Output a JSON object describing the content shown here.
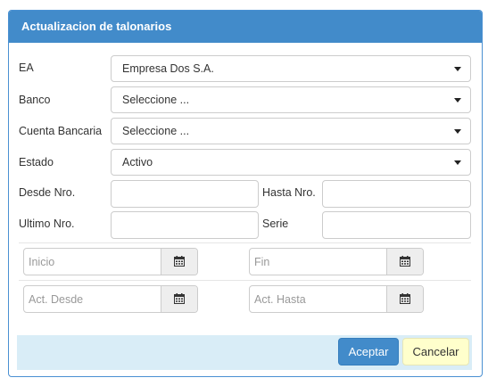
{
  "dialog": {
    "title": "Actualizacion de talonarios"
  },
  "form": {
    "ea": {
      "label": "EA",
      "value": "Empresa Dos S.A."
    },
    "banco": {
      "label": "Banco",
      "value": "Seleccione ..."
    },
    "cuenta": {
      "label": "Cuenta Bancaria",
      "value": "Seleccione ..."
    },
    "estado": {
      "label": "Estado",
      "value": "Activo"
    },
    "desde_nro": {
      "label": "Desde Nro.",
      "value": ""
    },
    "hasta_nro": {
      "label": "Hasta Nro.",
      "value": ""
    },
    "ultimo_nro": {
      "label": "Ultimo Nro.",
      "value": ""
    },
    "serie": {
      "label": "Serie",
      "value": ""
    },
    "inicio": {
      "placeholder": "Inicio"
    },
    "fin": {
      "placeholder": "Fin"
    },
    "act_desde": {
      "placeholder": "Act. Desde"
    },
    "act_hasta": {
      "placeholder": "Act. Hasta"
    }
  },
  "footer": {
    "accept_label": "Aceptar",
    "cancel_label": "Cancelar"
  },
  "colors": {
    "header": "#428bca",
    "footer": "#d9edf7",
    "cancel": "#ffffcc"
  },
  "icons": {
    "dropdown": "caret-down-icon",
    "calendar": "calendar-icon"
  }
}
